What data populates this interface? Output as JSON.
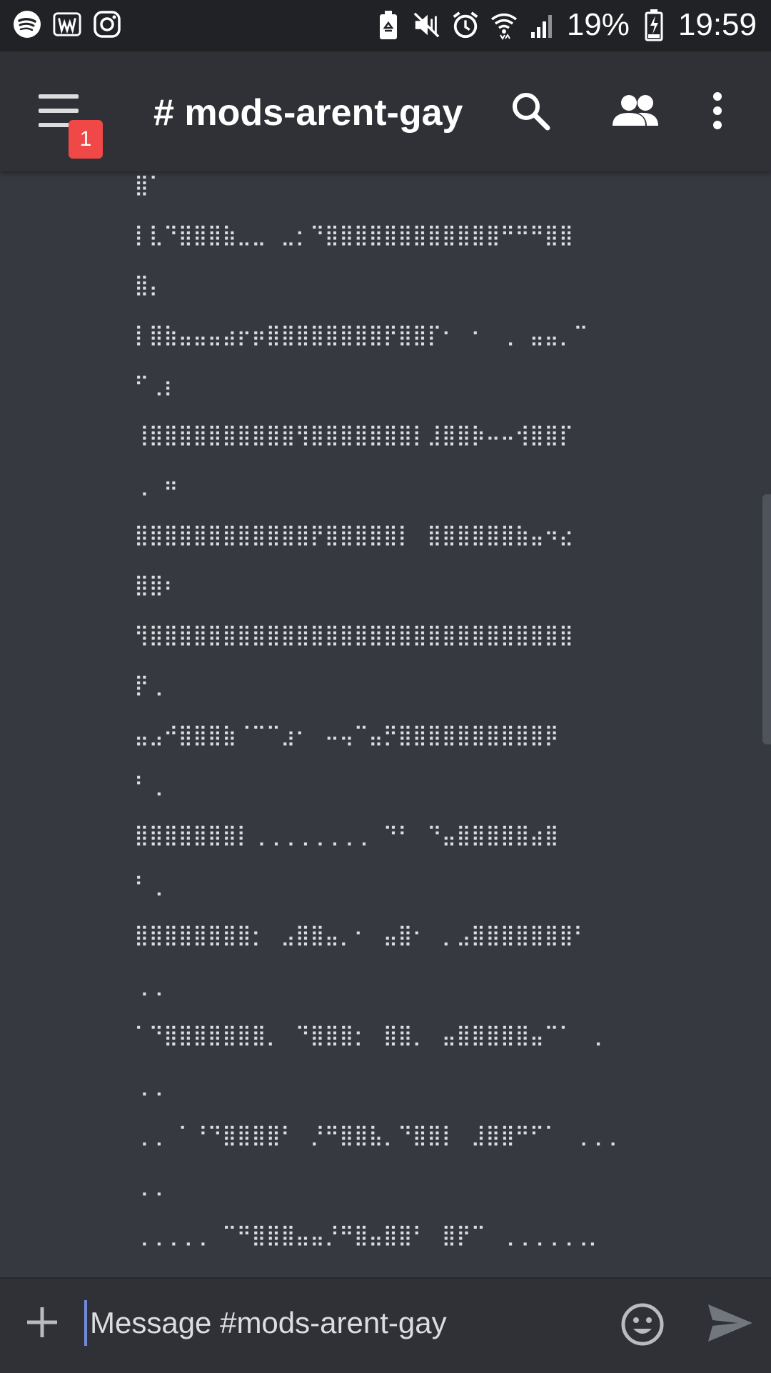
{
  "status_bar": {
    "battery_percent": "19%",
    "time": "19:59",
    "left_icons": [
      "spotify-icon",
      "webtoon-icon",
      "instagram-icon"
    ],
    "right_icons": [
      "battery-saver-icon",
      "mute-icon",
      "alarm-icon",
      "wifi-icon",
      "signal-icon",
      "battery-icon"
    ]
  },
  "header": {
    "channel_title": "# mods-arent-gay",
    "notification_count": "1",
    "icons": [
      "menu-icon",
      "search-icon",
      "members-icon",
      "more-icon"
    ]
  },
  "messages": {
    "lines": [
      "⣿⠁",
      "⡇⣇⠙⣿⣿⣿⣷⣀⣀⠀⣀⡂⠙⣿⣿⣿⣿⣿⣿⣿⣿⣿⣿⣿⣿⠛⠛⠛⣿⣿",
      "⣿⡄",
      "⡇⣿⣷⣤⣤⣤⣴⡖⡶⣿⣿⣿⣿⣿⣿⣿⣿⡟⣿⣿⡏⠂⠀⠂⠀⢀⠀⣤⣤⡀⠉",
      "⠋⢀⡆",
      "⢸⣿⣿⣿⣿⣿⣿⣿⣿⣿⣿⢻⣿⣿⣿⣿⣿⣿⣿⡇⣸⣿⣿⡷⠤⠤⢺⣿⣿⡏",
      "⢀⠀⠶",
      "⣿⣿⣿⣿⣿⣿⣿⣿⣿⣿⣿⣿⡟⣿⣿⣿⣿⣿⡇⠀⣿⣿⣿⣿⣿⣿⣷⣤⠲⣔",
      "⣿⣿⠆",
      "⢻⣿⣿⣿⣿⣿⣿⣿⣿⣿⣿⣿⣿⣿⣿⣿⣿⣿⣿⣿⣿⣿⣿⣿⣿⣿⣿⣿⣿⣿",
      "⡟⢀",
      "⣤⣠⠚⣿⣿⣿⣷⠈⠉⠉⣰⠂⠀⠤⢤⠉⣤⡛⣿⣿⣿⣿⣿⣿⣿⣿⣿⣿⡿",
      "⠃⢀",
      "⣿⣿⣿⣿⣿⣿⣿⡇⢀⢀⢀⢀⢀⢀⢀⢀⠀⠙⠃⠀⠙⣤⣿⣿⣿⣿⣿⣴⣿",
      "⠃⢀",
      "⣿⣿⣿⣿⣿⣿⣿⣿⡂⠀⣠⣿⣿⣤⡀⠂⠀⣤⣿⠂⠀⡀⣠⣿⣿⣿⣿⣿⣿⣿⠃",
      "⢀⢀",
      "⠁⠙⣿⣿⣿⣿⣿⣿⣿⡀⠀⠙⣿⣿⣿⡂⠀⣿⣿⡀⠀⣤⣿⣿⣿⣿⣿⣤⠉⠁⠀⢀",
      "⢀⢀",
      "⢀⢀⠀⠁⠘⠙⣿⣿⣿⣿⠃⠀⡘⠛⣿⣿⣧⡀⠙⣿⣿⡇⠀⣸⣿⣿⠛⠋⠁⠀⢀⢀⢀",
      "⢀⢀",
      "⢀⢀⢀⢀⢀⠀⠉⠛⣿⣿⣿⣤⣤⡘⠛⣿⣤⣿⣿⠃⠀⣿⡟⠉⠀⢀⢀⢀⢀⢀⢀⡀"
    ]
  },
  "input": {
    "placeholder": "Message #mods-arent-gay"
  },
  "colors": {
    "background": "#36393f",
    "header": "#2f3136",
    "status_bar": "#202225",
    "badge": "#f04747",
    "accent": "#7289da"
  }
}
